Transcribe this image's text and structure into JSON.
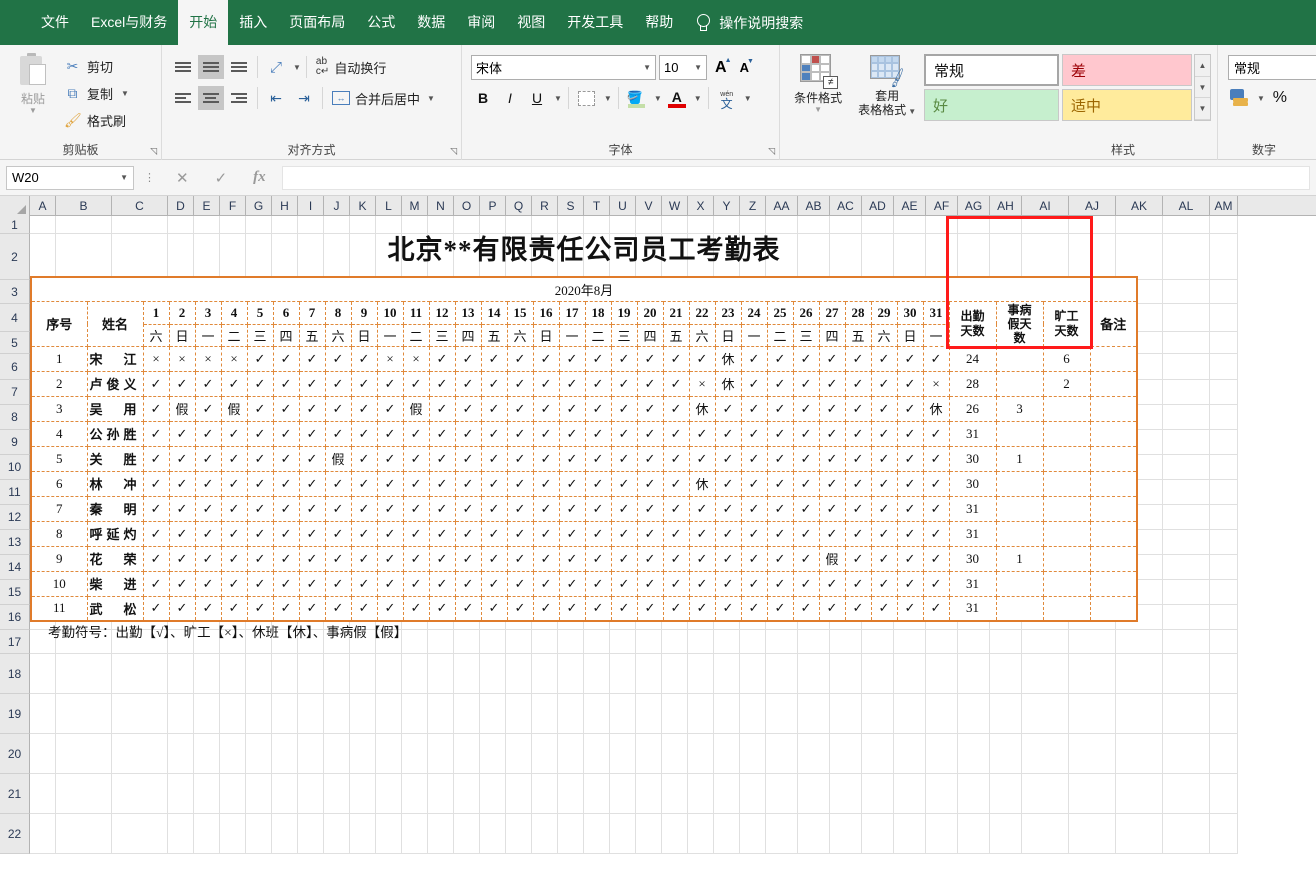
{
  "ribbon": {
    "tabs": [
      {
        "label": "文件",
        "active": false
      },
      {
        "label": "Excel与财务",
        "active": false
      },
      {
        "label": "开始",
        "active": true
      },
      {
        "label": "插入",
        "active": false
      },
      {
        "label": "页面布局",
        "active": false
      },
      {
        "label": "公式",
        "active": false
      },
      {
        "label": "数据",
        "active": false
      },
      {
        "label": "审阅",
        "active": false
      },
      {
        "label": "视图",
        "active": false
      },
      {
        "label": "开发工具",
        "active": false
      },
      {
        "label": "帮助",
        "active": false
      }
    ],
    "tell_me": "操作说明搜索",
    "groups": {
      "clipboard": {
        "title": "剪贴板",
        "paste": "粘贴",
        "cut": "剪切",
        "copy": "复制",
        "format_painter": "格式刷"
      },
      "alignment": {
        "title": "对齐方式",
        "wrap_text": "自动换行",
        "merge_center": "合并后居中"
      },
      "font": {
        "title": "字体",
        "font_name": "宋体",
        "font_size": "10",
        "bold": "B",
        "italic": "I",
        "underline": "U"
      },
      "styles": {
        "title": "样式",
        "conditional_formatting": "条件格式",
        "format_as_table_line1": "套用",
        "format_as_table_line2": "表格格式",
        "cells": [
          {
            "label": "常规",
            "kind": "normal"
          },
          {
            "label": "差",
            "kind": "bad"
          },
          {
            "label": "好",
            "kind": "good"
          },
          {
            "label": "适中",
            "kind": "neutral"
          }
        ]
      },
      "number": {
        "title": "数字",
        "format": "常规",
        "percent": "%"
      }
    }
  },
  "formula_bar": {
    "name_box": "W20",
    "cancel_icon": "✕",
    "confirm_icon": "✓",
    "fx_icon": "fx",
    "content": ""
  },
  "grid": {
    "column_headers": [
      "A",
      "B",
      "C",
      "D",
      "E",
      "F",
      "G",
      "H",
      "I",
      "J",
      "K",
      "L",
      "M",
      "N",
      "O",
      "P",
      "Q",
      "R",
      "S",
      "T",
      "U",
      "V",
      "W",
      "X",
      "Y",
      "Z",
      "AA",
      "AB",
      "AC",
      "AD",
      "AE",
      "AF",
      "AG",
      "AH",
      "AI",
      "AJ",
      "AK",
      "AL",
      "AM"
    ],
    "row_headers": [
      "1",
      "2",
      "3",
      "4",
      "5",
      "6",
      "7",
      "8",
      "9",
      "10",
      "11",
      "12",
      "13",
      "14",
      "15",
      "16",
      "17",
      "18",
      "19",
      "20",
      "21",
      "22"
    ]
  },
  "report": {
    "title": "北京**有限责任公司员工考勤表",
    "month": "2020年8月",
    "headers": {
      "index": "序号",
      "name": "姓名",
      "attend_days_l1": "出勤",
      "attend_days_l2": "天数",
      "leave_days_l1": "事病",
      "leave_days_l2": "假天",
      "leave_days_l3": "数",
      "absent_days_l1": "旷工",
      "absent_days_l2": "天数",
      "remark": "备注"
    },
    "days": [
      "1",
      "2",
      "3",
      "4",
      "5",
      "6",
      "7",
      "8",
      "9",
      "10",
      "11",
      "12",
      "13",
      "14",
      "15",
      "16",
      "17",
      "18",
      "19",
      "20",
      "21",
      "22",
      "23",
      "24",
      "25",
      "26",
      "27",
      "28",
      "29",
      "30",
      "31"
    ],
    "weekdays": [
      "六",
      "日",
      "一",
      "二",
      "三",
      "四",
      "五",
      "六",
      "日",
      "一",
      "二",
      "三",
      "四",
      "五",
      "六",
      "日",
      "一",
      "二",
      "三",
      "四",
      "五",
      "六",
      "日",
      "一",
      "二",
      "三",
      "四",
      "五",
      "六",
      "日",
      "一"
    ],
    "weekend_flags": [
      true,
      true,
      false,
      false,
      false,
      false,
      false,
      true,
      true,
      false,
      false,
      false,
      false,
      false,
      true,
      true,
      false,
      false,
      false,
      false,
      false,
      true,
      true,
      false,
      false,
      false,
      false,
      false,
      true,
      true,
      false
    ],
    "rows": [
      {
        "no": "1",
        "name": "宋　江",
        "marks": [
          "×",
          "×",
          "×",
          "×",
          "✓",
          "✓",
          "✓",
          "✓",
          "✓",
          "×",
          "×",
          "✓",
          "✓",
          "✓",
          "✓",
          "✓",
          "✓",
          "✓",
          "✓",
          "✓",
          "✓",
          "✓",
          "休",
          "✓",
          "✓",
          "✓",
          "✓",
          "✓",
          "✓",
          "✓",
          "✓"
        ],
        "attend": "24",
        "leave": "",
        "absent": "6",
        "remark": ""
      },
      {
        "no": "2",
        "name": "卢俊义",
        "marks": [
          "✓",
          "✓",
          "✓",
          "✓",
          "✓",
          "✓",
          "✓",
          "✓",
          "✓",
          "✓",
          "✓",
          "✓",
          "✓",
          "✓",
          "✓",
          "✓",
          "✓",
          "✓",
          "✓",
          "✓",
          "✓",
          "×",
          "休",
          "✓",
          "✓",
          "✓",
          "✓",
          "✓",
          "✓",
          "✓",
          "×"
        ],
        "attend": "28",
        "leave": "",
        "absent": "2",
        "remark": ""
      },
      {
        "no": "3",
        "name": "吴　用",
        "marks": [
          "✓",
          "假",
          "✓",
          "假",
          "✓",
          "✓",
          "✓",
          "✓",
          "✓",
          "✓",
          "假",
          "✓",
          "✓",
          "✓",
          "✓",
          "✓",
          "✓",
          "✓",
          "✓",
          "✓",
          "✓",
          "休",
          "✓",
          "✓",
          "✓",
          "✓",
          "✓",
          "✓",
          "✓",
          "✓",
          "休"
        ],
        "attend": "26",
        "leave": "3",
        "absent": "",
        "remark": ""
      },
      {
        "no": "4",
        "name": "公孙胜",
        "marks": [
          "✓",
          "✓",
          "✓",
          "✓",
          "✓",
          "✓",
          "✓",
          "✓",
          "✓",
          "✓",
          "✓",
          "✓",
          "✓",
          "✓",
          "✓",
          "✓",
          "✓",
          "✓",
          "✓",
          "✓",
          "✓",
          "✓",
          "✓",
          "✓",
          "✓",
          "✓",
          "✓",
          "✓",
          "✓",
          "✓",
          "✓"
        ],
        "attend": "31",
        "leave": "",
        "absent": "",
        "remark": ""
      },
      {
        "no": "5",
        "name": "关　胜",
        "marks": [
          "✓",
          "✓",
          "✓",
          "✓",
          "✓",
          "✓",
          "✓",
          "假",
          "✓",
          "✓",
          "✓",
          "✓",
          "✓",
          "✓",
          "✓",
          "✓",
          "✓",
          "✓",
          "✓",
          "✓",
          "✓",
          "✓",
          "✓",
          "✓",
          "✓",
          "✓",
          "✓",
          "✓",
          "✓",
          "✓",
          "✓"
        ],
        "attend": "30",
        "leave": "1",
        "absent": "",
        "remark": ""
      },
      {
        "no": "6",
        "name": "林　冲",
        "marks": [
          "✓",
          "✓",
          "✓",
          "✓",
          "✓",
          "✓",
          "✓",
          "✓",
          "✓",
          "✓",
          "✓",
          "✓",
          "✓",
          "✓",
          "✓",
          "✓",
          "✓",
          "✓",
          "✓",
          "✓",
          "✓",
          "休",
          "✓",
          "✓",
          "✓",
          "✓",
          "✓",
          "✓",
          "✓",
          "✓",
          "✓"
        ],
        "attend": "30",
        "leave": "",
        "absent": "",
        "remark": ""
      },
      {
        "no": "7",
        "name": "秦　明",
        "marks": [
          "✓",
          "✓",
          "✓",
          "✓",
          "✓",
          "✓",
          "✓",
          "✓",
          "✓",
          "✓",
          "✓",
          "✓",
          "✓",
          "✓",
          "✓",
          "✓",
          "✓",
          "✓",
          "✓",
          "✓",
          "✓",
          "✓",
          "✓",
          "✓",
          "✓",
          "✓",
          "✓",
          "✓",
          "✓",
          "✓",
          "✓"
        ],
        "attend": "31",
        "leave": "",
        "absent": "",
        "remark": ""
      },
      {
        "no": "8",
        "name": "呼延灼",
        "marks": [
          "✓",
          "✓",
          "✓",
          "✓",
          "✓",
          "✓",
          "✓",
          "✓",
          "✓",
          "✓",
          "✓",
          "✓",
          "✓",
          "✓",
          "✓",
          "✓",
          "✓",
          "✓",
          "✓",
          "✓",
          "✓",
          "✓",
          "✓",
          "✓",
          "✓",
          "✓",
          "✓",
          "✓",
          "✓",
          "✓",
          "✓"
        ],
        "attend": "31",
        "leave": "",
        "absent": "",
        "remark": ""
      },
      {
        "no": "9",
        "name": "花　荣",
        "marks": [
          "✓",
          "✓",
          "✓",
          "✓",
          "✓",
          "✓",
          "✓",
          "✓",
          "✓",
          "✓",
          "✓",
          "✓",
          "✓",
          "✓",
          "✓",
          "✓",
          "✓",
          "✓",
          "✓",
          "✓",
          "✓",
          "✓",
          "✓",
          "✓",
          "✓",
          "✓",
          "假",
          "✓",
          "✓",
          "✓",
          "✓"
        ],
        "attend": "30",
        "leave": "1",
        "absent": "",
        "remark": ""
      },
      {
        "no": "10",
        "name": "柴　进",
        "marks": [
          "✓",
          "✓",
          "✓",
          "✓",
          "✓",
          "✓",
          "✓",
          "✓",
          "✓",
          "✓",
          "✓",
          "✓",
          "✓",
          "✓",
          "✓",
          "✓",
          "✓",
          "✓",
          "✓",
          "✓",
          "✓",
          "✓",
          "✓",
          "✓",
          "✓",
          "✓",
          "✓",
          "✓",
          "✓",
          "✓",
          "✓"
        ],
        "attend": "31",
        "leave": "",
        "absent": "",
        "remark": ""
      },
      {
        "no": "11",
        "name": "武　松",
        "marks": [
          "✓",
          "✓",
          "✓",
          "✓",
          "✓",
          "✓",
          "✓",
          "✓",
          "✓",
          "✓",
          "✓",
          "✓",
          "✓",
          "✓",
          "✓",
          "✓",
          "✓",
          "✓",
          "✓",
          "✓",
          "✓",
          "✓",
          "✓",
          "✓",
          "✓",
          "✓",
          "✓",
          "✓",
          "✓",
          "✓",
          "✓"
        ],
        "attend": "31",
        "leave": "",
        "absent": "",
        "remark": ""
      }
    ],
    "legend": "考勤符号：出勤【√】、旷工【×】、休班【休】、事病假【假】"
  },
  "colors": {
    "ribbon_green": "#217346",
    "weekend_fill": "#cfdfb5",
    "table_border": "#e07b2a",
    "highlight_box": "#ff1a1a"
  }
}
